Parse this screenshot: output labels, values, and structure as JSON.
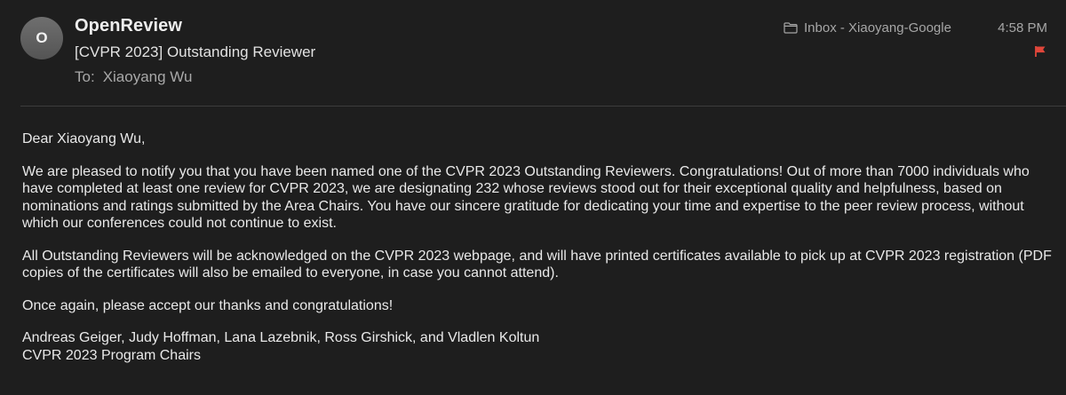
{
  "header": {
    "avatar_initial": "O",
    "sender": "OpenReview",
    "subject": "[CVPR 2023] Outstanding Reviewer",
    "to_label": "To:",
    "to_name": "Xiaoyang Wu",
    "mailbox": "Inbox - Xiaoyang-Google",
    "time": "4:58 PM",
    "flag_color": "#e0463a"
  },
  "body": {
    "greeting": "Dear Xiaoyang Wu,",
    "paragraphs": [
      "We are pleased to notify you that you have been named one of the CVPR 2023 Outstanding Reviewers. Congratulations! Out of more than 7000 individuals who have completed at least one review for CVPR 2023, we are designating 232 whose reviews stood out for their exceptional quality and helpfulness, based on nominations and ratings submitted by the Area Chairs. You have our sincere gratitude for dedicating your time and expertise to the peer review process, without which our conferences could not continue to exist.",
      "All Outstanding Reviewers will be acknowledged on the CVPR 2023 webpage, and will have printed certificates available to pick up at CVPR 2023 registration (PDF copies of the certificates will also be emailed to everyone, in case you cannot attend).",
      "Once again, please accept our thanks and congratulations!"
    ],
    "signature_names": "Andreas Geiger, Judy Hoffman, Lana Lazebnik, Ross Girshick, and Vladlen Koltun",
    "signature_title": "CVPR 2023 Program Chairs"
  }
}
